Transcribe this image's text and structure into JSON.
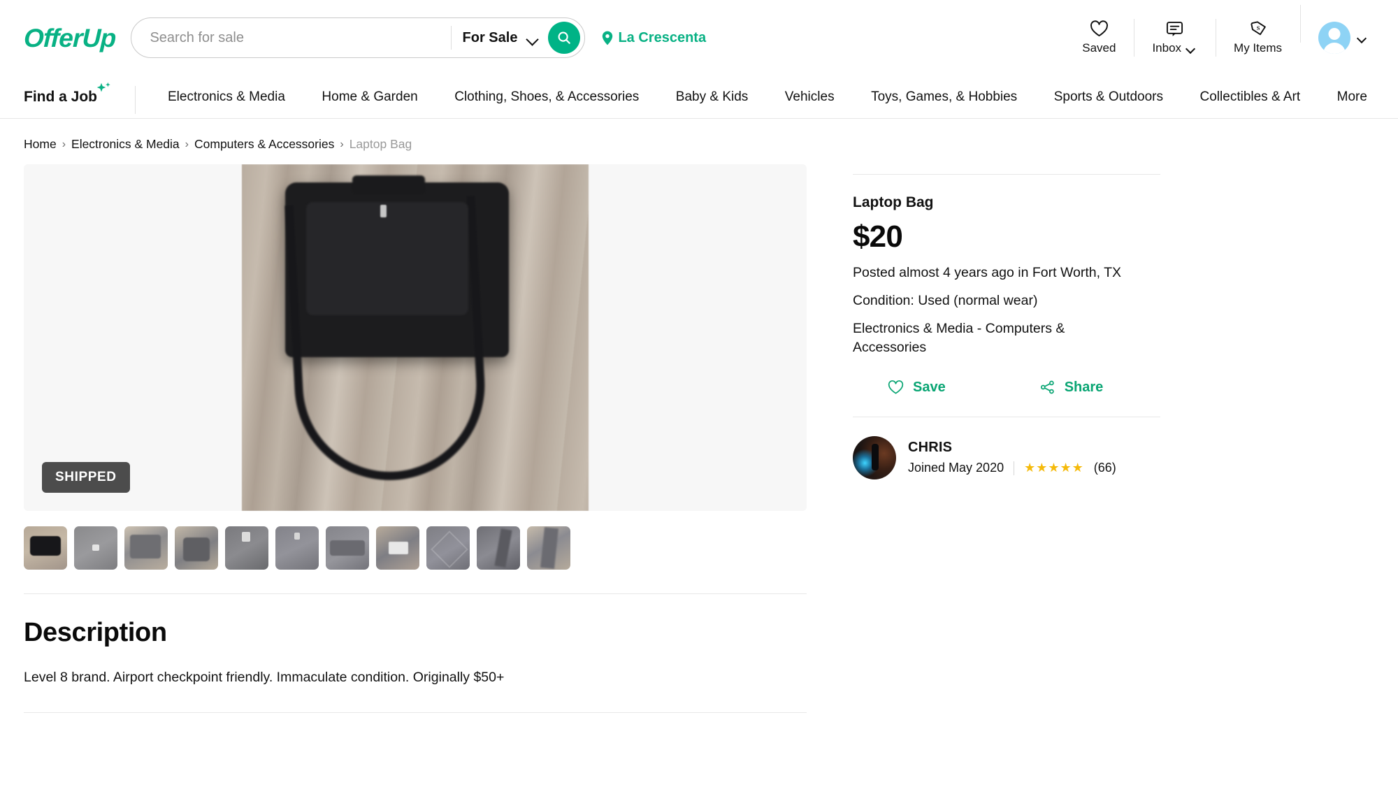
{
  "header": {
    "brand": "OfferUp",
    "search": {
      "placeholder": "Search for sale",
      "value": "",
      "category_label": "For Sale",
      "search_icon": "search-icon"
    },
    "location": {
      "label": "La Crescenta",
      "icon": "location-pin-icon"
    },
    "actions": [
      {
        "label": "Saved",
        "icon": "heart-icon",
        "has_chevron": false
      },
      {
        "label": "Inbox",
        "icon": "message-bubble-icon",
        "has_chevron": true
      },
      {
        "label": "My Items",
        "icon": "price-tag-icon",
        "has_chevron": false
      }
    ],
    "account": {
      "icon": "user-avatar-icon",
      "has_chevron": true
    }
  },
  "nav": {
    "find_a_job": "Find a Job",
    "items": [
      "Electronics & Media",
      "Home & Garden",
      "Clothing, Shoes, & Accessories",
      "Baby & Kids",
      "Vehicles",
      "Toys, Games, & Hobbies",
      "Sports & Outdoors",
      "Collectibles & Art",
      "More"
    ]
  },
  "breadcrumb": {
    "items": [
      "Home",
      "Electronics & Media",
      "Computers & Accessories"
    ],
    "current": "Laptop Bag",
    "separator": "›"
  },
  "gallery": {
    "badge": "SHIPPED",
    "thumbnail_count": 11,
    "selected_index": 0,
    "alt": "Black laptop bag with shoulder strap on wooden floor"
  },
  "listing": {
    "title": "Laptop Bag",
    "price": "$20",
    "posted": "Posted almost 4 years ago in Fort Worth, TX",
    "condition": "Condition: Used (normal wear)",
    "category": "Electronics & Media - Computers & Accessories",
    "save_label": "Save",
    "share_label": "Share"
  },
  "seller": {
    "name": "CHRIS",
    "joined": "Joined May 2020",
    "stars": "★★★★★",
    "rating_value": 5,
    "rating_count": "(66)"
  },
  "description": {
    "heading": "Description",
    "body": "Level 8 brand. Airport checkpoint friendly. Immaculate condition. Originally $50+"
  },
  "colors": {
    "brand_green": "#08b184",
    "action_green": "#09a573",
    "search_button_green": "#00b386",
    "badge_gray": "#4c4c4c",
    "star_gold": "#f5ba0b"
  }
}
